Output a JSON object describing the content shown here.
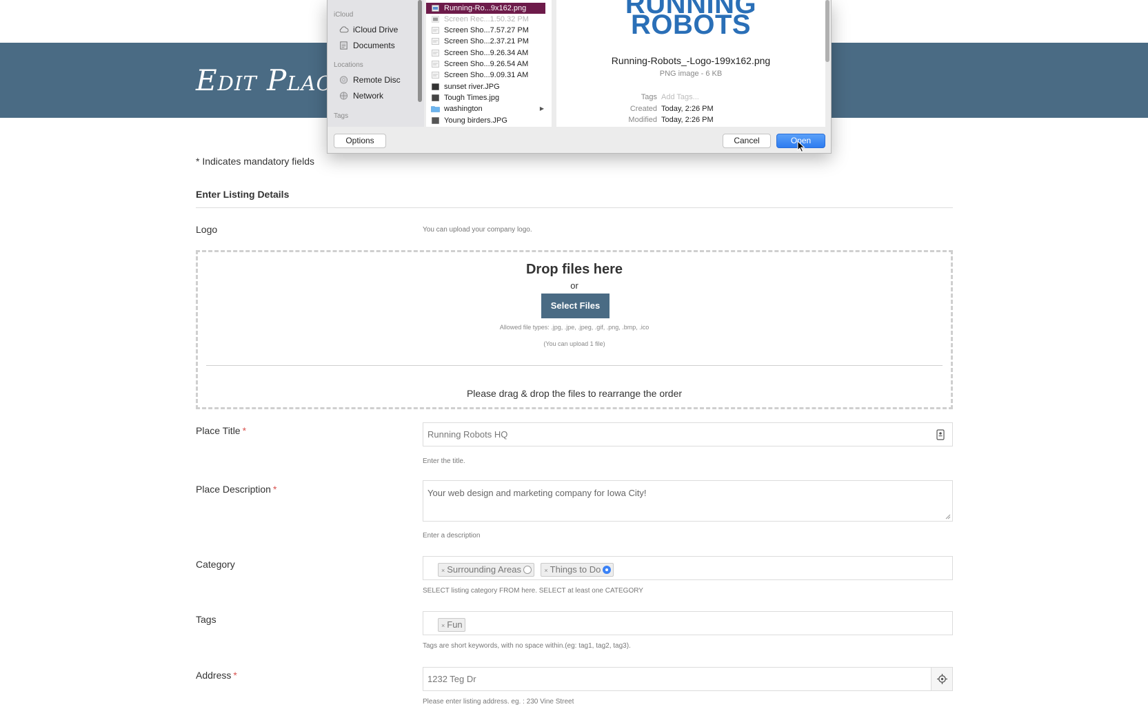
{
  "page": {
    "title": "Edit Place",
    "mandatory_note": "* Indicates mandatory fields",
    "section_heading": "Enter Listing Details"
  },
  "logo": {
    "label": "Logo",
    "hint": "You can upload your company logo.",
    "dropzone": {
      "title": "Drop files here",
      "or": "or",
      "button": "Select Files",
      "allowed": "Allowed file types: .jpg, .jpe, .jpeg, .gif, .png, .bmp, .ico",
      "limit": "(You can upload 1 file)",
      "reorder": "Please drag & drop the files to rearrange the order"
    }
  },
  "place_title": {
    "label": "Place Title",
    "required": "*",
    "value": "Running Robots HQ",
    "hint": "Enter the title.",
    "icon": "contact-card-icon"
  },
  "place_description": {
    "label": "Place Description",
    "required": "*",
    "value": "Your web design and marketing company for Iowa City!",
    "hint": "Enter a description"
  },
  "category": {
    "label": "Category",
    "chips": [
      {
        "label": "Surrounding Areas",
        "remove": "×",
        "selected": false
      },
      {
        "label": "Things to Do",
        "remove": "×",
        "selected": true
      }
    ],
    "hint": "SELECT listing category FROM here. SELECT at least one CATEGORY"
  },
  "tags": {
    "label": "Tags",
    "chips": [
      {
        "label": "Fun",
        "remove": "×"
      }
    ],
    "hint": "Tags are short keywords, with no space within.(eg: tag1, tag2, tag3)."
  },
  "address": {
    "label": "Address",
    "required": "*",
    "value": "1232 Teg Dr",
    "hint": "Please enter listing address. eg. : 230 Vine Street",
    "icon": "locate-crosshair-icon"
  },
  "file_dialog": {
    "sidebar": {
      "sections": [
        {
          "heading": "iCloud",
          "items": [
            {
              "label": "iCloud Drive",
              "icon": "cloud-icon"
            },
            {
              "label": "Documents",
              "icon": "documents-icon"
            }
          ]
        },
        {
          "heading": "Locations",
          "items": [
            {
              "label": "Remote Disc",
              "icon": "disc-icon"
            },
            {
              "label": "Network",
              "icon": "globe-icon"
            }
          ]
        },
        {
          "heading": "Tags",
          "items": []
        }
      ]
    },
    "files": [
      {
        "name": "Running-Ro...9x162.png",
        "selected": true,
        "dimmed": false
      },
      {
        "name": "Screen Rec...1.50.32 PM",
        "selected": false,
        "dimmed": true
      },
      {
        "name": "Screen Sho...7.57.27 PM",
        "selected": false,
        "dimmed": false
      },
      {
        "name": "Screen Sho...2.37.21 PM",
        "selected": false,
        "dimmed": false
      },
      {
        "name": "Screen Sho...9.26.34 AM",
        "selected": false,
        "dimmed": false
      },
      {
        "name": "Screen Sho...9.26.54 AM",
        "selected": false,
        "dimmed": false
      },
      {
        "name": "Screen Sho...9.09.31 AM",
        "selected": false,
        "dimmed": false
      },
      {
        "name": "sunset river.JPG",
        "selected": false,
        "dimmed": false
      },
      {
        "name": "Tough Times.jpg",
        "selected": false,
        "dimmed": false
      },
      {
        "name": "washington",
        "selected": false,
        "dimmed": false,
        "folder": true
      },
      {
        "name": "Young birders.JPG",
        "selected": false,
        "dimmed": false
      }
    ],
    "preview": {
      "logo_line1": "RUNNING",
      "logo_line2": "ROBOTS",
      "filename": "Running-Robots_-Logo-199x162.png",
      "kind": "PNG image - 6 KB",
      "meta": [
        {
          "key": "Tags",
          "value": "Add Tags...",
          "placeholder": true
        },
        {
          "key": "Created",
          "value": "Today, 2:26 PM",
          "placeholder": false
        },
        {
          "key": "Modified",
          "value": "Today, 2:26 PM",
          "placeholder": false
        }
      ]
    },
    "buttons": {
      "options": "Options",
      "cancel": "Cancel",
      "open": "Open"
    }
  },
  "colors": {
    "hero": "#4a6b84",
    "selected_file": "#6d1b4a",
    "primary_button": "#2d7cf0",
    "required": "#d9534f",
    "logo_blue": "#2a6fb7"
  }
}
